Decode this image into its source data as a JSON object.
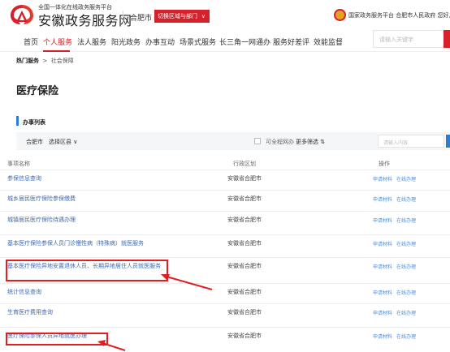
{
  "header": {
    "site_subtitle": "全国一体化在线政务服务平台",
    "site_title": "安徽政务服务网",
    "city": "合肥市",
    "switch_label": "切换区域与部门",
    "right_text": "国家政务服务平台 合肥市人民政府 您好,"
  },
  "nav": {
    "items": [
      "首页",
      "个人服务",
      "法人服务",
      "阳光政务",
      "办事互动",
      "场景式服务",
      "长三角一网通办",
      "服务好差评",
      "效能监督"
    ],
    "active_index": 1,
    "search_placeholder": "请输入关键字"
  },
  "breadcrumb": {
    "root": "热门服务",
    "sep": ">",
    "current": "社会保障"
  },
  "page_title": "医疗保险",
  "section_title": "办事列表",
  "filter": {
    "city": "合肥市",
    "area": "选择区县 ∨",
    "online_label": "可全程网办",
    "more_label": "更多筛选 ⇅",
    "input_placeholder": "请输入内容"
  },
  "table": {
    "headers": [
      "事项名称",
      "行政区划",
      "操作"
    ],
    "rows": [
      {
        "name": "参保信息查询",
        "region": "安徽省合肥市",
        "act1": "申请材料",
        "act2": "在线办理"
      },
      {
        "name": "城乡居民医疗保险参保缴费",
        "region": "安徽省合肥市",
        "act1": "申请材料",
        "act2": "在线办理"
      },
      {
        "name": "城镇居民医疗保险待遇办理",
        "region": "安徽省合肥市",
        "act1": "申请材料",
        "act2": "在线办理"
      },
      {
        "name": "基本医疗保险参保人员门诊慢性病（特殊病）就医服务",
        "region": "安徽省合肥市",
        "act1": "申请材料",
        "act2": "在线办理"
      },
      {
        "name": "基本医疗保险异地安置退休人员、长期异地居住人员就医服务",
        "region": "安徽省合肥市",
        "act1": "申请材料",
        "act2": "在线办理"
      },
      {
        "name": "统计信息查询",
        "region": "安徽省合肥市",
        "act1": "申请材料",
        "act2": "在线办理"
      },
      {
        "name": "生育医疗费用查询",
        "region": "安徽省合肥市",
        "act1": "申请材料",
        "act2": "在线办理"
      },
      {
        "name": "医疗保险参保人员异地就医办理",
        "region": "安徽省合肥市",
        "act1": "申请材料",
        "act2": "在线办理"
      }
    ]
  },
  "colors": {
    "brand_red": "#d6212b",
    "link_blue": "#3f6ab4",
    "accent_blue": "#2a7fd4",
    "annotation_red": "#e02020"
  }
}
